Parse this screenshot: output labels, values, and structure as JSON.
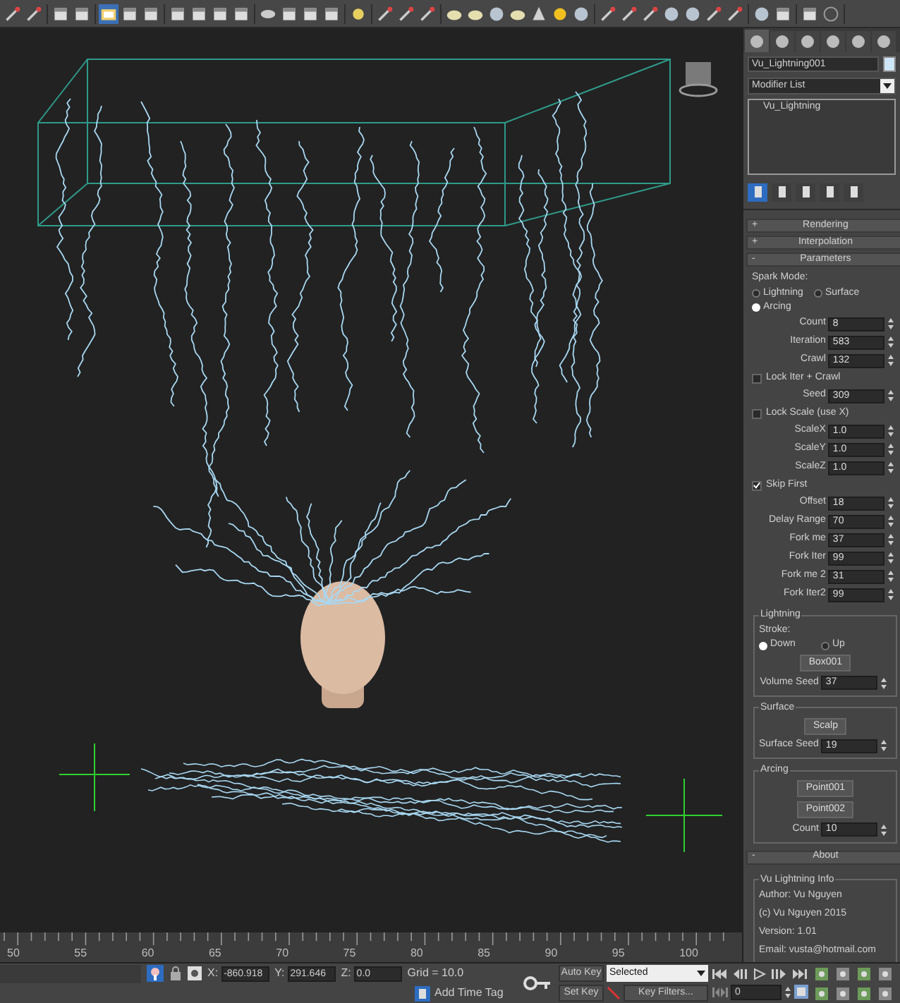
{
  "toolbar_buttons": [
    {
      "selected": false
    },
    {
      "selected": false
    },
    {
      "selected": false
    },
    {
      "selected": false
    },
    {
      "selected": true
    },
    {
      "selected": false
    },
    {
      "selected": false
    },
    {
      "selected": false
    },
    {
      "selected": false
    },
    {
      "selected": false
    },
    {
      "selected": false
    },
    {
      "selected": false
    },
    {
      "selected": false
    },
    {
      "selected": false
    },
    {
      "selected": false
    },
    {
      "selected": false
    },
    {
      "selected": false
    },
    {
      "selected": false
    },
    {
      "selected": false
    },
    {
      "selected": false
    },
    {
      "selected": false
    },
    {
      "selected": false
    },
    {
      "selected": false
    },
    {
      "selected": false
    },
    {
      "selected": false
    },
    {
      "selected": false
    },
    {
      "selected": false
    },
    {
      "selected": false
    },
    {
      "selected": false
    },
    {
      "selected": false
    },
    {
      "selected": false
    },
    {
      "selected": false
    },
    {
      "selected": false
    },
    {
      "selected": false
    },
    {
      "selected": false
    },
    {
      "selected": false
    },
    {
      "selected": false
    }
  ],
  "command_panel": {
    "tabs": [
      {
        "selected": true
      },
      {
        "selected": false
      },
      {
        "selected": false
      },
      {
        "selected": false
      },
      {
        "selected": false
      },
      {
        "selected": false
      }
    ],
    "object_name": "Vu_Lightning001",
    "modifier_list": "Modifier List",
    "modifier_stack": [
      "Vu_Lightning"
    ],
    "stack_buttons": [
      {
        "selected": true
      },
      {
        "selected": false
      },
      {
        "selected": false
      },
      {
        "selected": false
      },
      {
        "selected": false
      }
    ],
    "rollouts": [
      {
        "symbol": "+",
        "title": "Rendering"
      },
      {
        "symbol": "+",
        "title": "Interpolation"
      },
      {
        "symbol": "-",
        "title": "Parameters",
        "controls": [
          {
            "kind": "label",
            "text": "Spark Mode:"
          },
          {
            "kind": "radios",
            "options": [
              {
                "label": "Lightning",
                "selected": false
              },
              {
                "label": "Surface",
                "selected": false
              },
              {
                "label": "Arcing",
                "selected": true
              }
            ]
          },
          {
            "kind": "spinner",
            "label": "Count",
            "value": "8"
          },
          {
            "kind": "spinner",
            "label": "Iteration",
            "value": "583"
          },
          {
            "kind": "spinner",
            "label": "Crawl",
            "value": "132"
          },
          {
            "kind": "checkbox",
            "label": "Lock Iter + Crawl",
            "checked": false
          },
          {
            "kind": "spinner",
            "label": "Seed",
            "value": "309"
          },
          {
            "kind": "checkbox",
            "label": "Lock Scale (use X)",
            "checked": false
          },
          {
            "kind": "spinner",
            "label": "ScaleX",
            "value": "1.0"
          },
          {
            "kind": "spinner",
            "label": "ScaleY",
            "value": "1.0"
          },
          {
            "kind": "spinner",
            "label": "ScaleZ",
            "value": "1.0"
          },
          {
            "kind": "checkbox",
            "label": "Skip First",
            "checked": true
          },
          {
            "kind": "spinner",
            "label": "Offset",
            "value": "18"
          },
          {
            "kind": "spinner",
            "label": "Delay Range",
            "value": "70"
          },
          {
            "kind": "spinner",
            "label": "Fork me",
            "value": "37"
          },
          {
            "kind": "spinner",
            "label": "Fork Iter",
            "value": "99"
          },
          {
            "kind": "spinner",
            "label": "Fork me 2",
            "value": "31"
          },
          {
            "kind": "spinner",
            "label": "Fork Iter2",
            "value": "99"
          },
          {
            "kind": "group",
            "title": "Lightning",
            "controls": [
              {
                "kind": "label",
                "text": "Stroke:"
              },
              {
                "kind": "radios",
                "options": [
                  {
                    "label": "Down",
                    "selected": true
                  },
                  {
                    "label": "Up",
                    "selected": false
                  }
                ]
              },
              {
                "kind": "button",
                "label": "Box001"
              },
              {
                "kind": "spinner",
                "label": "Volume Seed",
                "value": "37"
              }
            ]
          },
          {
            "kind": "group",
            "title": "Surface",
            "controls": [
              {
                "kind": "button",
                "label": "Scalp"
              },
              {
                "kind": "spinner",
                "label": "Surface Seed",
                "value": "19"
              }
            ]
          },
          {
            "kind": "group",
            "title": "Arcing",
            "controls": [
              {
                "kind": "button",
                "label": "Point001"
              },
              {
                "kind": "button",
                "label": "Point002"
              },
              {
                "kind": "spinner",
                "label": "Count",
                "value": "10"
              }
            ]
          }
        ]
      },
      {
        "symbol": "-",
        "title": "About",
        "controls": [
          {
            "kind": "group",
            "title": "Vu Lightning Info",
            "controls": [
              {
                "kind": "text",
                "text": "Author: Vu Nguyen"
              },
              {
                "kind": "text",
                "text": "(c) Vu Nguyen 2015"
              },
              {
                "kind": "text",
                "text": "Version: 1.01"
              },
              {
                "kind": "text",
                "text": "Email: vusta@hotmail.com"
              }
            ]
          }
        ]
      }
    ]
  },
  "timeline": {
    "ticks": [
      "50",
      "55",
      "60",
      "65",
      "70",
      "75",
      "80",
      "85",
      "90",
      "95",
      "100"
    ]
  },
  "status_bar": {
    "coordinates": [
      {
        "axis": "X:",
        "value": "-860.918"
      },
      {
        "axis": "Y:",
        "value": "291.646"
      },
      {
        "axis": "Z:",
        "value": "0.0"
      }
    ],
    "grid": "Grid = 10.0",
    "time_tag": "Add Time Tag",
    "auto_key": "Auto Key",
    "set_key": "Set Key",
    "key_mode": "Selected",
    "key_filters": "Key Filters...",
    "current_frame": "0"
  }
}
